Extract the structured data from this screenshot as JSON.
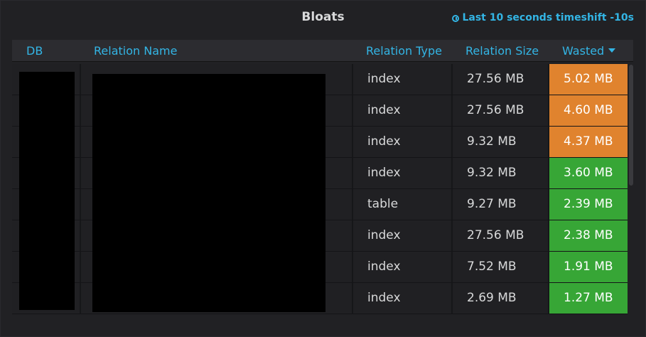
{
  "panel": {
    "title": "Bloats",
    "timeshift": "Last 10 seconds timeshift -10s",
    "icon": "clock-icon"
  },
  "table": {
    "columns": [
      "DB",
      "Relation Name",
      "Relation Type",
      "Relation Size",
      "Wasted"
    ],
    "sort_column": "Wasted",
    "sort_direction": "desc",
    "rows": [
      {
        "type": "index",
        "size": "27.56 MB",
        "wasted": "5.02 MB",
        "status": "warning"
      },
      {
        "type": "index",
        "size": "27.56 MB",
        "wasted": "4.60 MB",
        "status": "warning"
      },
      {
        "type": "index",
        "size": "9.32 MB",
        "wasted": "4.37 MB",
        "status": "warning"
      },
      {
        "type": "index",
        "size": "9.32 MB",
        "wasted": "3.60 MB",
        "status": "ok"
      },
      {
        "type": "table",
        "size": "9.27 MB",
        "wasted": "2.39 MB",
        "status": "ok"
      },
      {
        "type": "index",
        "size": "27.56 MB",
        "wasted": "2.38 MB",
        "status": "ok"
      },
      {
        "type": "index",
        "size": "7.52 MB",
        "wasted": "1.91 MB",
        "status": "ok"
      },
      {
        "type": "index",
        "size": "2.69 MB",
        "wasted": "1.27 MB",
        "status": "ok"
      }
    ]
  },
  "colors": {
    "accent": "#33b5e5",
    "warning": "#e0832e",
    "ok": "#37a636",
    "background": "#212124"
  }
}
